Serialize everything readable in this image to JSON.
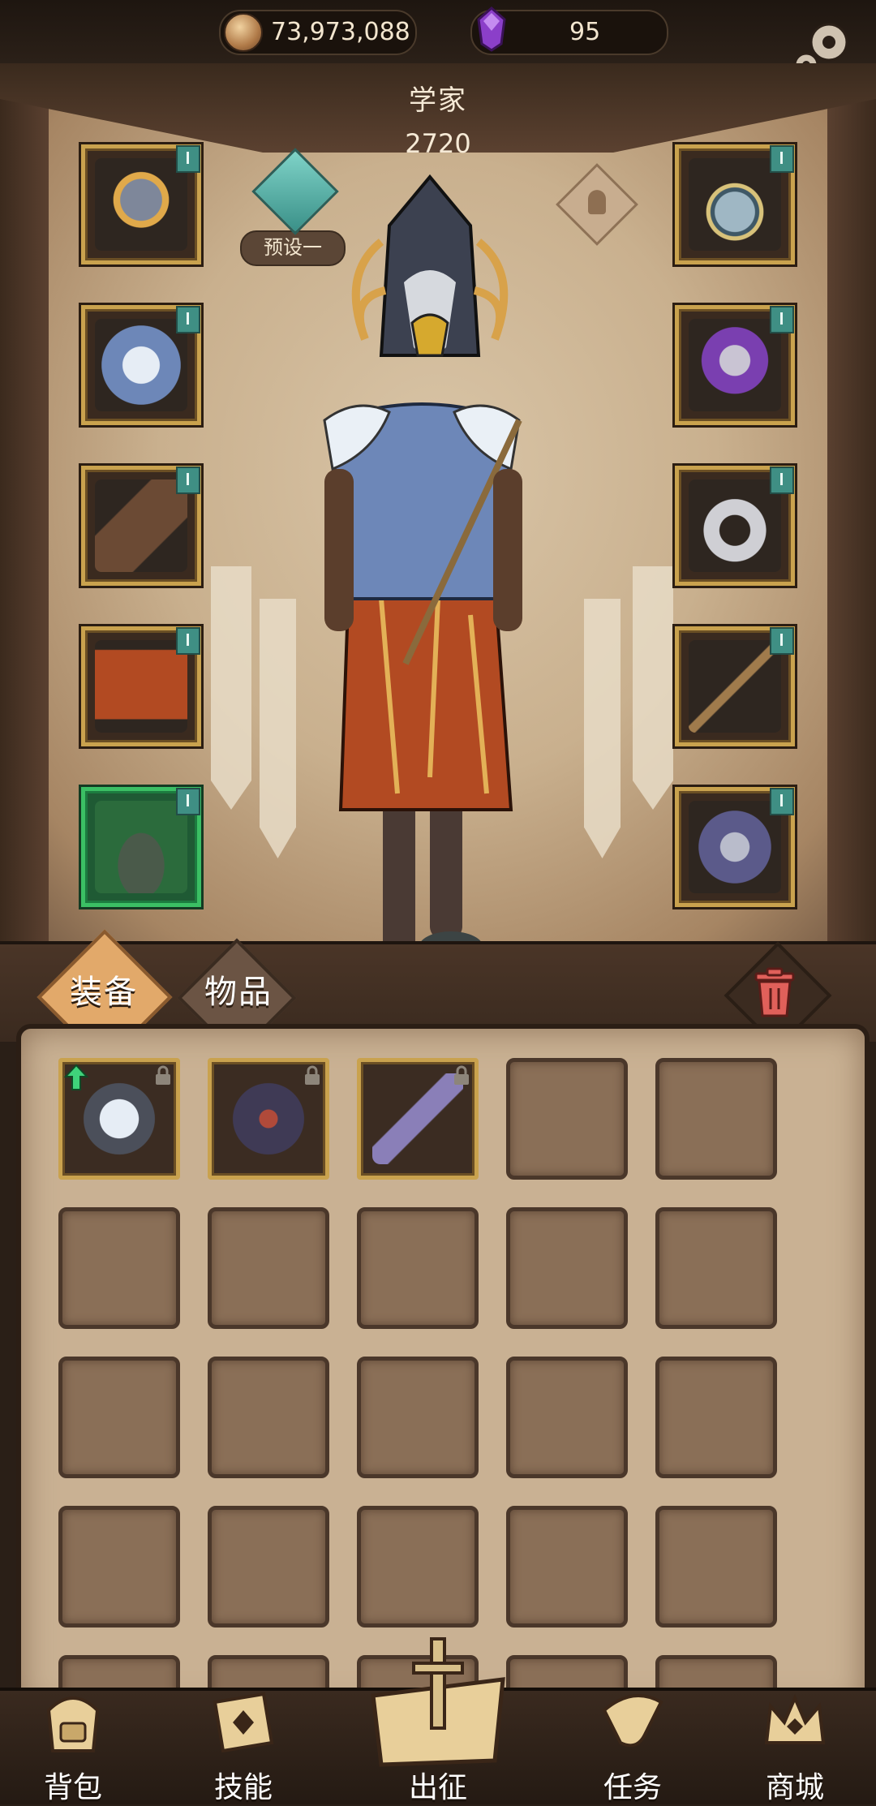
{
  "resources": {
    "gold": "73,973,088",
    "gems": "95"
  },
  "hero": {
    "class_name": "学家",
    "power": "2720",
    "preset_label": "预设一"
  },
  "equipment_slots": [
    {
      "slot": "head",
      "art": "hooded-mask-icon",
      "rarity": "gold"
    },
    {
      "slot": "chest",
      "art": "cloud-armor-icon",
      "rarity": "gold"
    },
    {
      "slot": "gloves",
      "art": "leather-glove-icon",
      "rarity": "gold"
    },
    {
      "slot": "legs",
      "art": "red-skirt-icon",
      "rarity": "gold"
    },
    {
      "slot": "boots",
      "art": "moss-boots-icon",
      "rarity": "green"
    },
    {
      "slot": "necklace",
      "art": "amulet-icon",
      "rarity": "gold"
    },
    {
      "slot": "offhand",
      "art": "skull-gauntlet-icon",
      "rarity": "gold"
    },
    {
      "slot": "ring",
      "art": "silver-ring-icon",
      "rarity": "gold"
    },
    {
      "slot": "weapon",
      "art": "wand-icon",
      "rarity": "gold"
    },
    {
      "slot": "cloak",
      "art": "dragon-armor-icon",
      "rarity": "gold"
    }
  ],
  "inventory": {
    "tabs": [
      {
        "label": "装备",
        "active": true
      },
      {
        "label": "物品",
        "active": false
      }
    ],
    "items": [
      {
        "art": "white-armor-icon",
        "locked": true,
        "upgrade": true
      },
      {
        "art": "dark-helm-icon",
        "locked": true,
        "upgrade": false
      },
      {
        "art": "purple-staff-icon",
        "locked": true,
        "upgrade": false
      }
    ],
    "empty_slots_shown": 22
  },
  "nav": [
    {
      "label": "背包",
      "icon": "backpack-icon"
    },
    {
      "label": "技能",
      "icon": "skill-book-icon"
    },
    {
      "label": "出征",
      "icon": "sword-map-icon"
    },
    {
      "label": "任务",
      "icon": "scroll-icon"
    },
    {
      "label": "商城",
      "icon": "crown-shop-icon"
    }
  ],
  "colors": {
    "gold_frame": "#c9a24e",
    "green_frame": "#3bbf64",
    "preset_teal": "#3a9088",
    "tab_active": "#e2a96a",
    "trash_red": "#e0605a"
  }
}
